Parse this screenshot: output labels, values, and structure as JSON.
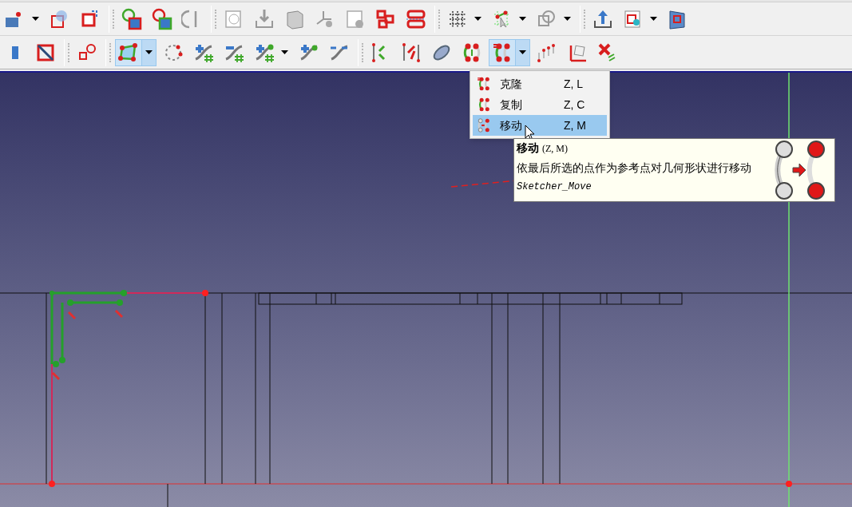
{
  "toolbars": [
    {
      "groups": [
        [
          {
            "kind": "dropdown",
            "selected": false
          },
          {
            "kind": "button",
            "selected": false
          },
          {
            "kind": "button",
            "selected": false
          }
        ],
        [
          {
            "kind": "button",
            "selected": false
          },
          {
            "kind": "button",
            "selected": false
          },
          {
            "kind": "button",
            "selected": false
          }
        ],
        [
          {
            "kind": "button",
            "selected": false
          },
          {
            "kind": "button",
            "selected": false
          },
          {
            "kind": "button",
            "selected": false
          },
          {
            "kind": "button",
            "selected": false
          },
          {
            "kind": "button",
            "selected": false
          },
          {
            "kind": "button",
            "selected": false
          },
          {
            "kind": "button",
            "selected": false
          }
        ],
        [
          {
            "kind": "dropdown",
            "selected": false
          },
          {
            "kind": "dropdown",
            "selected": false
          },
          {
            "kind": "dropdown",
            "selected": false
          }
        ],
        [
          {
            "kind": "button",
            "selected": false
          },
          {
            "kind": "dropdown",
            "selected": false
          },
          {
            "kind": "button",
            "selected": false
          }
        ]
      ]
    },
    {
      "groups": [
        [
          {
            "kind": "button",
            "selected": false
          },
          {
            "kind": "button",
            "selected": false
          }
        ],
        [
          {
            "kind": "button",
            "selected": false
          }
        ],
        [
          {
            "kind": "dropdown",
            "selected": true
          },
          {
            "kind": "button",
            "selected": false
          },
          {
            "kind": "button",
            "selected": false
          },
          {
            "kind": "button",
            "selected": false
          },
          {
            "kind": "dropdown",
            "selected": false
          },
          {
            "kind": "button",
            "selected": false
          },
          {
            "kind": "button",
            "selected": false
          }
        ],
        [
          {
            "kind": "button",
            "selected": false
          },
          {
            "kind": "button",
            "selected": false
          },
          {
            "kind": "button",
            "selected": false
          },
          {
            "kind": "button",
            "selected": false
          },
          {
            "kind": "dropdown",
            "selected": true
          },
          {
            "kind": "button",
            "selected": false
          },
          {
            "kind": "button",
            "selected": false
          },
          {
            "kind": "button",
            "selected": false
          }
        ]
      ]
    }
  ],
  "menu": {
    "items": [
      {
        "label": "克隆",
        "shortcut": "Z, L",
        "selected": false
      },
      {
        "label": "复制",
        "shortcut": "Z, C",
        "selected": false
      },
      {
        "label": "移动",
        "shortcut": "Z, M",
        "selected": true
      }
    ]
  },
  "tooltip": {
    "title": "移动",
    "shortcut": "(Z, M)",
    "description": "依最后所选的点作为参考点对几何形状进行移动",
    "command": "Sketcher_Move"
  }
}
